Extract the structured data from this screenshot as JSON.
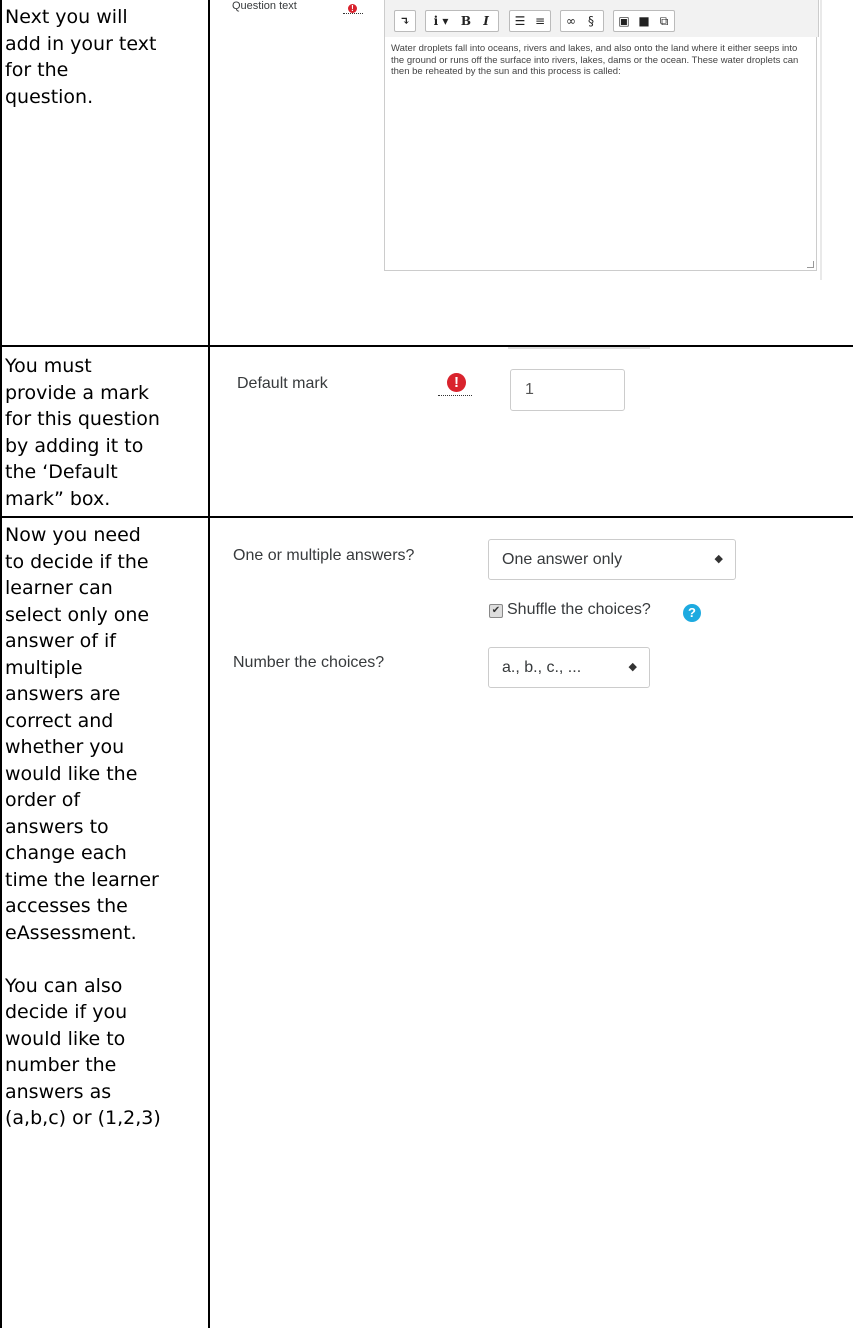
{
  "rows": [
    {
      "instruction": "Next you will\nadd in your text\nfor the\nquestion.",
      "form": {
        "label": "Question text",
        "required_icon": "exclamation-required-icon",
        "editor_text": "Water droplets fall into oceans, rivers and lakes, and also onto the land where it either seeps into the ground or runs off the surface into rivers, lakes, dams or the ocean. These water droplets can then be reheated by the sun and this process is called:",
        "toolbar": [
          "toggle-toolbar-icon",
          "paragraph-styles-icon",
          "bold-icon",
          "italic-icon",
          "unordered-list-icon",
          "ordered-list-icon",
          "link-icon",
          "unlink-icon",
          "image-icon",
          "media-icon",
          "manage-files-icon"
        ]
      }
    },
    {
      "instruction": "You must\nprovide a mark\nfor this question\nby adding it to\nthe ‘Default\nmark” box.",
      "form": {
        "label": "Default mark",
        "required_icon": "exclamation-required-icon",
        "value": "1"
      }
    },
    {
      "instruction": "Now you need\nto decide if the\nlearner can\nselect only one\nanswer of if\nmultiple\nanswers are\ncorrect and\nwhether you\nwould like the\norder of\nanswers to\nchange each\ntime the learner\naccesses the\neAssessment.\n\nYou can also\ndecide if you\nwould like to\nnumber the\nanswers as\n(a,b,c) or (1,2,3)",
      "form": {
        "answers_label": "One or multiple answers?",
        "answers_value": "One answer only",
        "shuffle_label": "Shuffle the choices?",
        "shuffle_checked": true,
        "number_label": "Number the choices?",
        "number_value": "a., b., c., ..."
      }
    }
  ]
}
